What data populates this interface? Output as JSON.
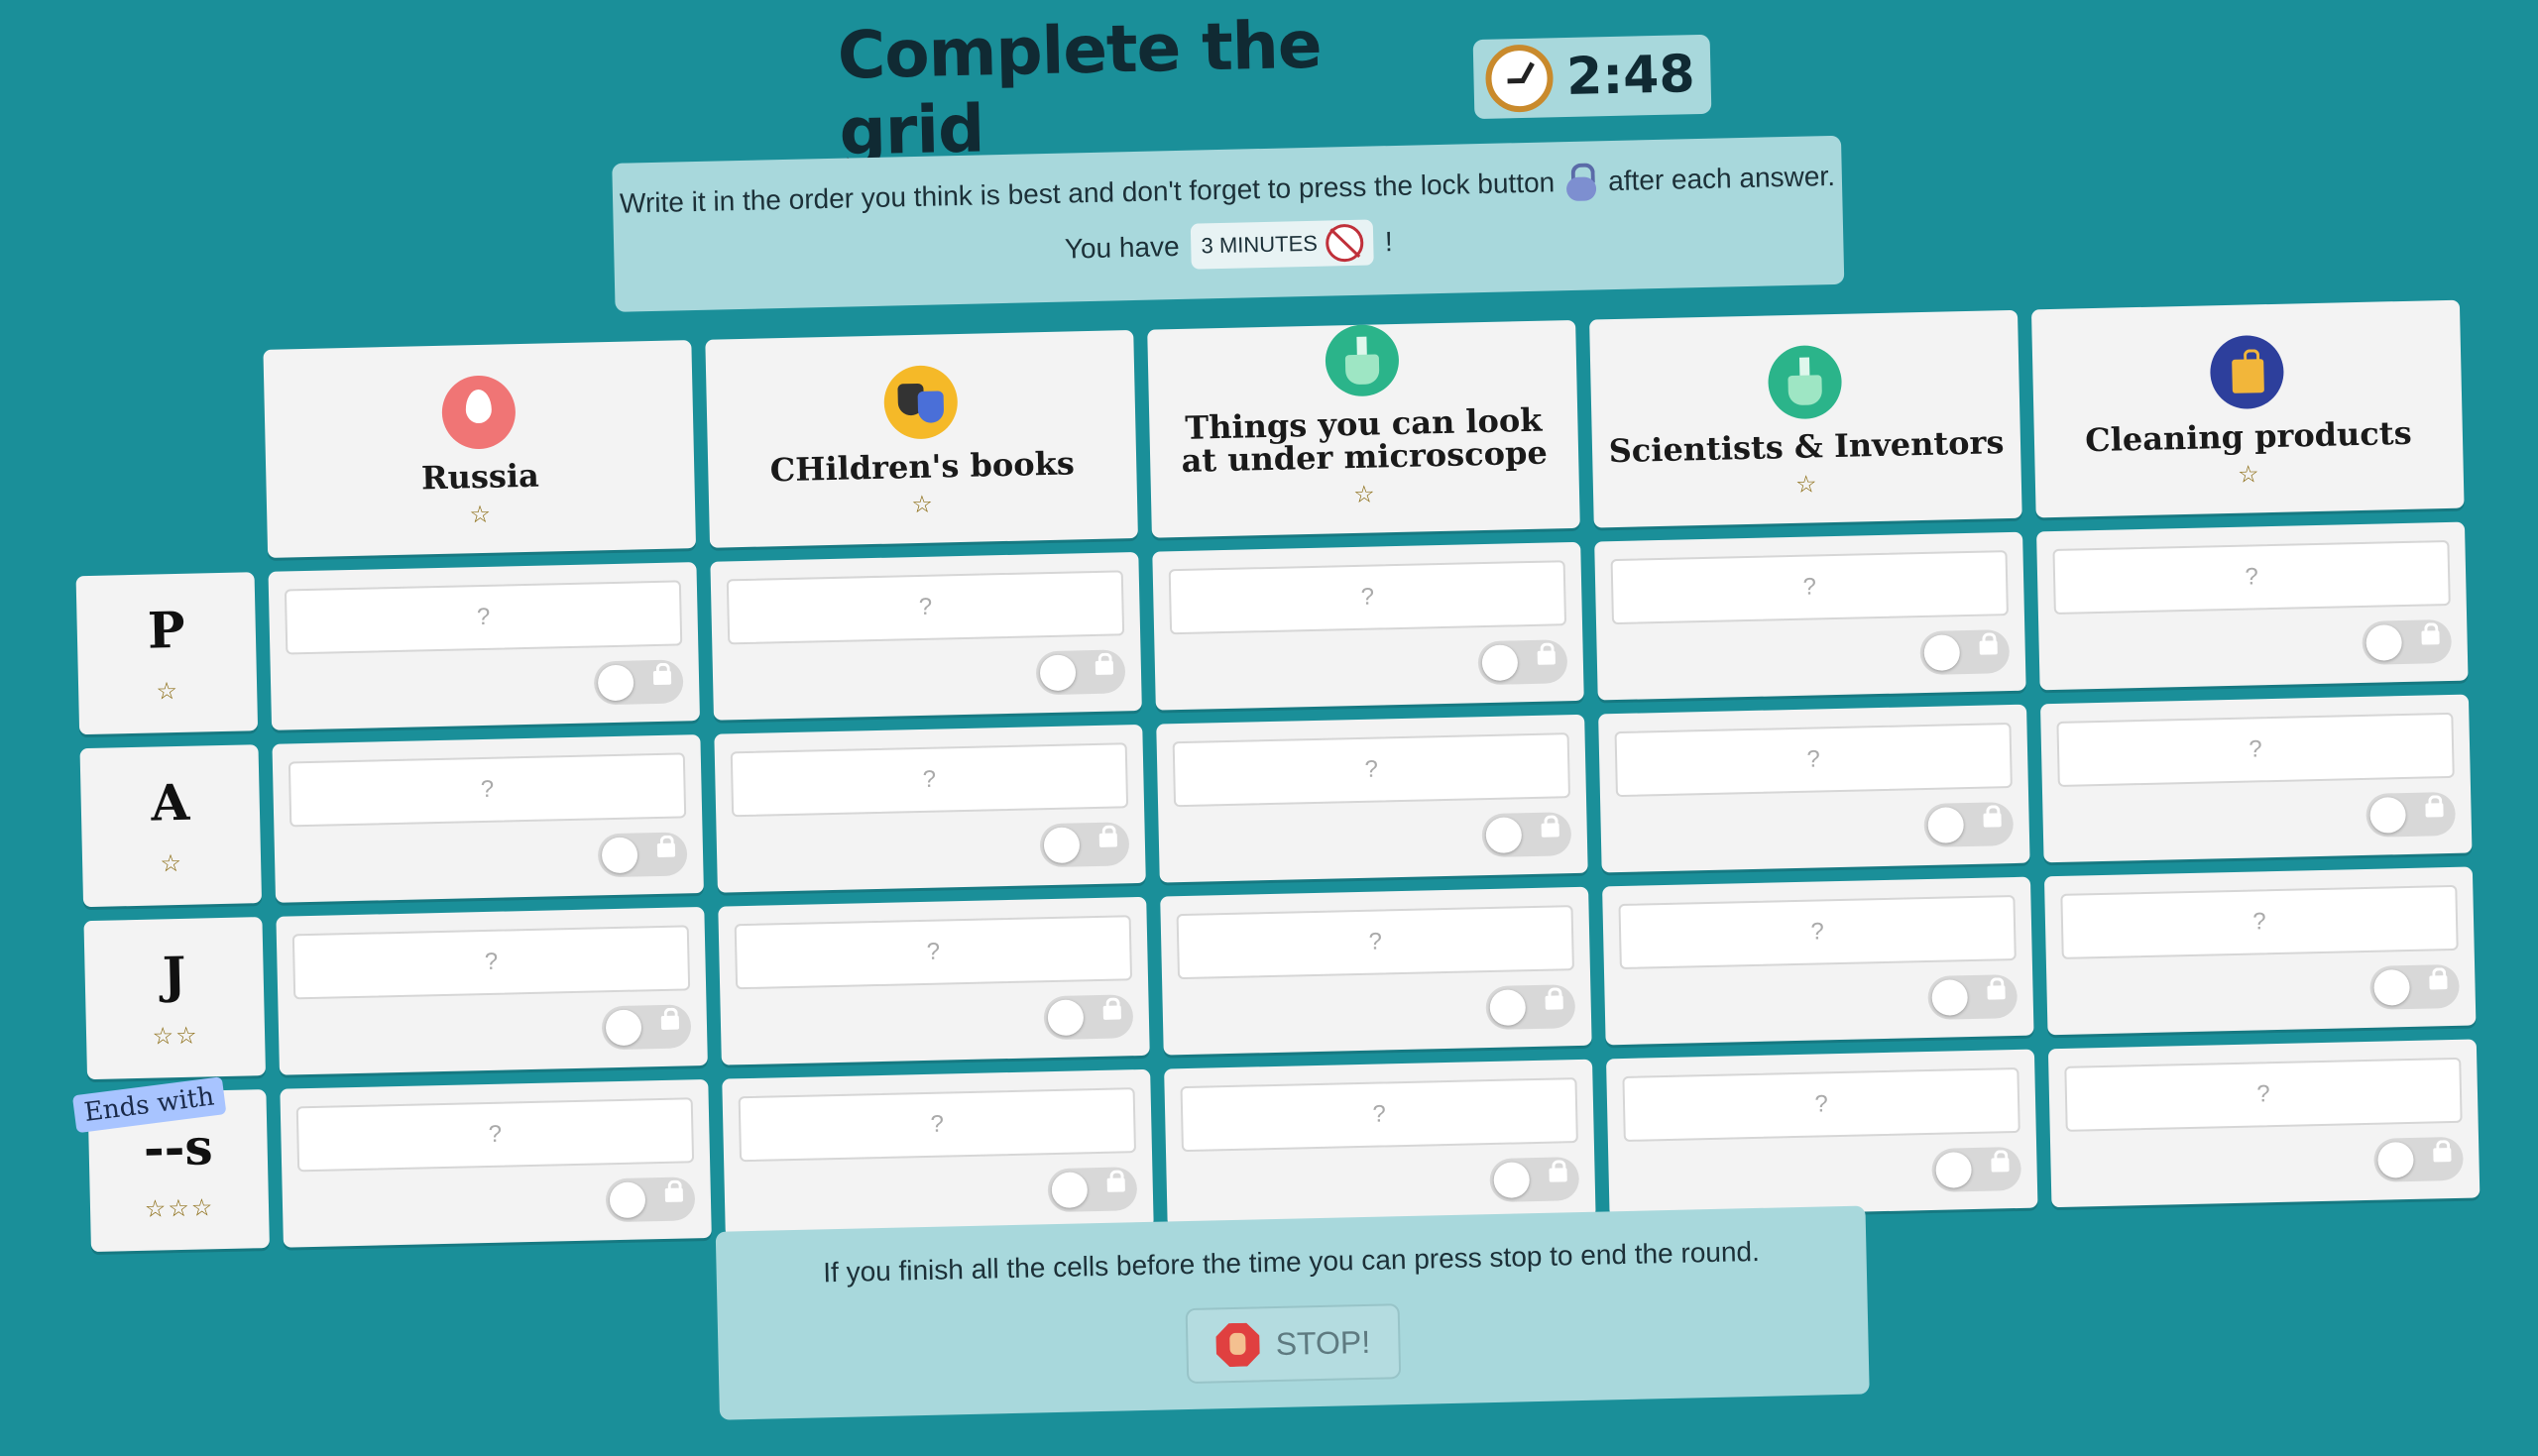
{
  "header": {
    "title": "Complete the grid",
    "timer": "2:48"
  },
  "instructions": {
    "line1_before": "Write it in the order you think is best and don't forget to press the lock button",
    "line1_after": "after each answer.",
    "line2_before": "You have",
    "duration_pill": "3 MINUTES",
    "line2_after": "!"
  },
  "categories": [
    {
      "title": "Russia",
      "stars": "☆",
      "icon": "location-pin-icon"
    },
    {
      "title": "CHildren's books",
      "stars": "☆",
      "icon": "theater-masks-icon"
    },
    {
      "title": "Things you can look at under microscope",
      "stars": "☆",
      "icon": "flask-icon"
    },
    {
      "title": "Scientists & Inventors",
      "stars": "☆",
      "icon": "flask-icon"
    },
    {
      "title": "Cleaning products",
      "stars": "☆",
      "icon": "shopping-bag-icon"
    }
  ],
  "rows": [
    {
      "letter": "P",
      "stars": "☆"
    },
    {
      "letter": "A",
      "stars": "☆"
    },
    {
      "letter": "J",
      "stars": "☆☆"
    },
    {
      "letter": "--s",
      "stars": "☆☆☆",
      "badge": "Ends with"
    }
  ],
  "cell": {
    "placeholder": "?"
  },
  "footer": {
    "text": "If you finish all the cells before the time you can press stop to end the round.",
    "stop_label": "STOP!"
  }
}
